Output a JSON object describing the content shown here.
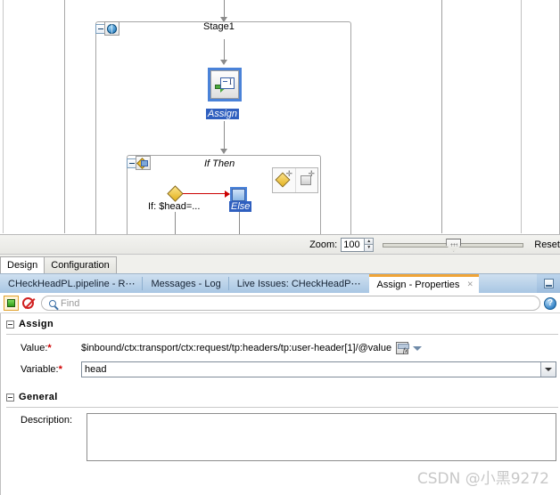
{
  "canvas": {
    "stage": {
      "title": "Stage1",
      "collapse_icon": "collapse-minus-icon",
      "stage_icon": "globe-stage-icon"
    },
    "assign_node": {
      "label": "Assign",
      "icon": "assign-arrow-textfield-icon",
      "selected": true
    },
    "ifthen": {
      "title": "If Then",
      "collapse_icon": "collapse-minus-icon",
      "icon": "ifthen-branch-icon",
      "condition_label": "If: $head=...",
      "else_label": "Else",
      "tools": [
        {
          "name": "add-condition-button",
          "icon": "yellow-diamond-plus-icon"
        },
        {
          "name": "add-default-button",
          "icon": "grey-square-plus-icon"
        }
      ]
    }
  },
  "zoombar": {
    "label": "Zoom:",
    "value": "100",
    "spin_up": "▲",
    "spin_down": "▼",
    "reset_label": "Reset",
    "slider_position_percent": 45
  },
  "design_tabs": [
    {
      "label": "Design",
      "active": true
    },
    {
      "label": "Configuration",
      "active": false
    }
  ],
  "view_tabs": [
    {
      "label": "CHeckHeadPL.pipeline - R⋯",
      "active": false
    },
    {
      "label": "Messages - Log",
      "active": false
    },
    {
      "label": "Live Issues: CHeckHeadP⋯",
      "active": false
    },
    {
      "label": "Assign - Properties",
      "active": true,
      "close_label": "×"
    }
  ],
  "view_tabs_minimize_icon": "minimize-window-icon",
  "findbar": {
    "toggle_icon": "green-square-toggle-icon",
    "disable_icon": "no-entry-icon",
    "search_icon": "search-icon",
    "placeholder": "Find",
    "value": "",
    "help_icon": "help-question-icon"
  },
  "properties": {
    "assign_section": {
      "title": "Assign",
      "collapse_icon": "collapse-minus-icon",
      "value_field": {
        "label": "Value:",
        "required_mark": "*",
        "value": "$inbound/ctx:transport/ctx:request/tp:headers/tp:user-header[1]/@value",
        "expression_icon": "fx-expression-builder-icon",
        "dropdown_icon": "chevron-down-icon"
      },
      "variable_field": {
        "label": "Variable:",
        "required_mark": "*",
        "value": "head",
        "dropdown_icon": "chevron-down-icon"
      }
    },
    "general_section": {
      "title": "General",
      "collapse_icon": "collapse-minus-icon",
      "description_field": {
        "label": "Description:",
        "value": ""
      }
    }
  },
  "watermark": "CSDN @小黑9272",
  "colors": {
    "selection_blue": "#2f5fbf",
    "active_tab_accent": "#f0a437",
    "required_red": "#d00000",
    "tabbar_blue": "#a8c6e3"
  }
}
